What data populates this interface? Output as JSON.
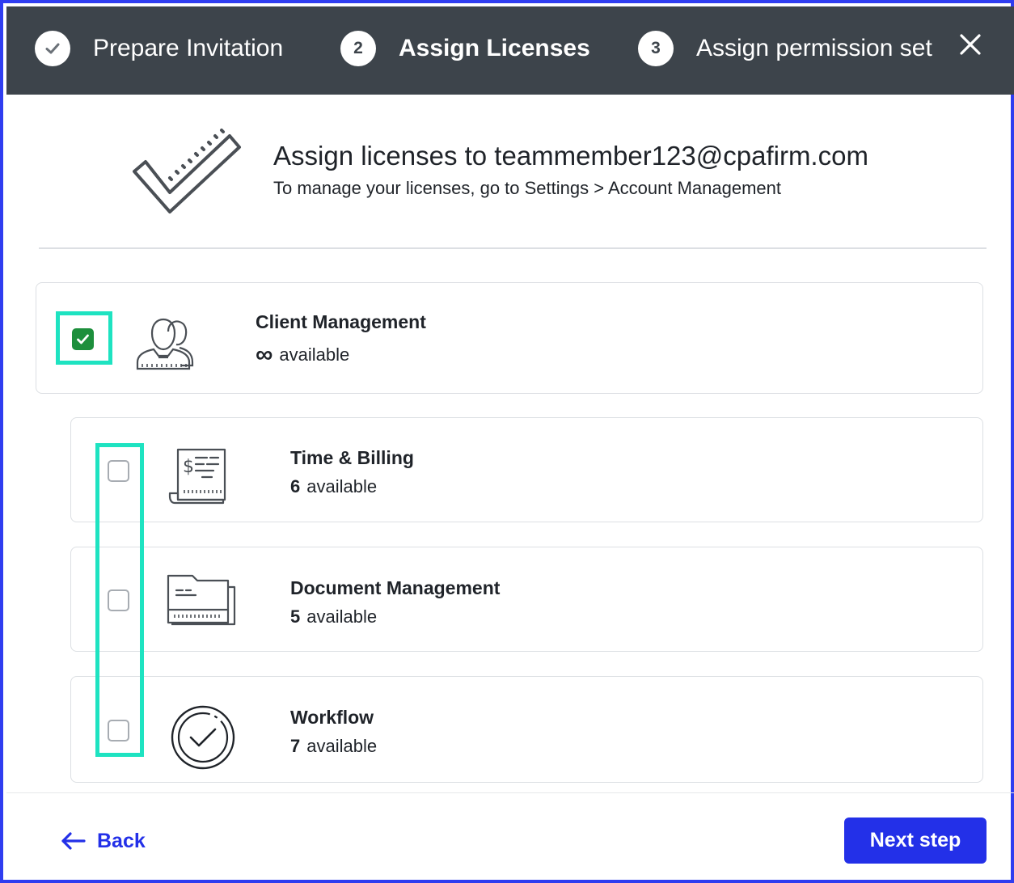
{
  "stepper": {
    "steps": [
      {
        "number": "",
        "label": "Prepare Invitation",
        "state": "completed",
        "icon": "check-icon"
      },
      {
        "number": "2",
        "label": "Assign Licenses",
        "state": "active"
      },
      {
        "number": "3",
        "label": "Assign permission set",
        "state": "upcoming"
      }
    ],
    "close_icon": "close-icon"
  },
  "intro": {
    "heading": "Assign licenses to teammember123@cpafirm.com",
    "subheading": "To manage your licenses, go to Settings > Account Management",
    "icon": "checkmark-illustration-icon"
  },
  "licenses": [
    {
      "title": "Client Management",
      "count": "",
      "count_symbol": "∞",
      "suffix": "available",
      "checked": true,
      "icon": "users-icon"
    },
    {
      "title": "Time & Billing",
      "count": "6",
      "suffix": "available",
      "checked": false,
      "icon": "invoice-icon"
    },
    {
      "title": "Document Management",
      "count": "5",
      "suffix": "available",
      "checked": false,
      "icon": "folder-icon"
    },
    {
      "title": "Workflow",
      "count": "7",
      "suffix": "available",
      "checked": false,
      "icon": "check-circle-icon"
    }
  ],
  "footer": {
    "back_label": "Back",
    "next_label": "Next step"
  },
  "colors": {
    "header_bg": "#3d444b",
    "accent_blue": "#2330e8",
    "checkbox_checked": "#1d8f3c",
    "highlight": "#1ee3c1",
    "frame_border": "#2f3df0"
  }
}
